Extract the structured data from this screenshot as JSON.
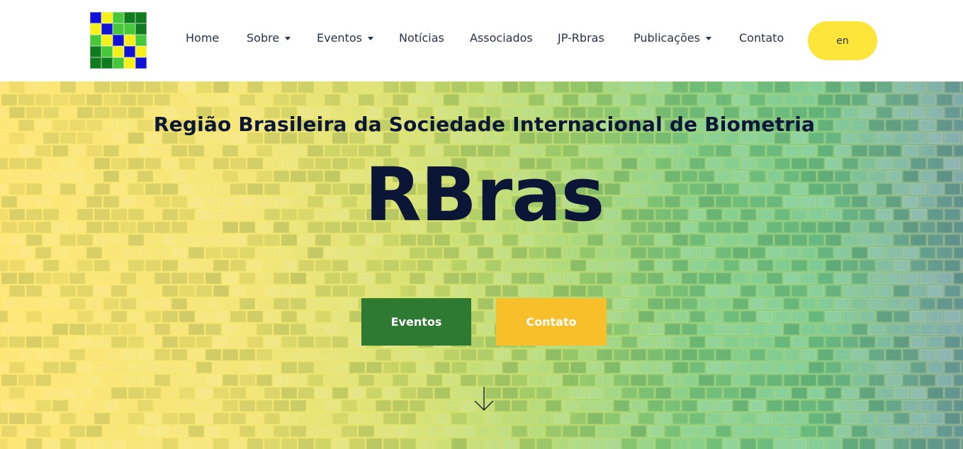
{
  "logo": {
    "cells": [
      "#1010d8",
      "#f5ef1a",
      "#46c83a",
      "#0f7a1e",
      "#0f7a1e",
      "#f5ef1a",
      "#1010d8",
      "#46c83a",
      "#46c83a",
      "#0f7a1e",
      "#46c83a",
      "#f5ef1a",
      "#1010d8",
      "#f5ef1a",
      "#46c83a",
      "#0f7a1e",
      "#46c83a",
      "#f5ef1a",
      "#1010d8",
      "#f5ef1a",
      "#0f7a1e",
      "#0f7a1e",
      "#46c83a",
      "#f5ef1a",
      "#1010d8"
    ]
  },
  "nav": {
    "items": [
      {
        "label": "Home",
        "dropdown": false
      },
      {
        "label": "Sobre",
        "dropdown": true
      },
      {
        "label": "Eventos",
        "dropdown": true
      },
      {
        "label": "Notícias",
        "dropdown": false
      },
      {
        "label": "Associados",
        "dropdown": false
      },
      {
        "label": "JP-Rbras",
        "dropdown": false
      },
      {
        "label": "Publicações",
        "dropdown": true
      },
      {
        "label": "Contato",
        "dropdown": false
      }
    ],
    "lang_label": "en"
  },
  "hero": {
    "subtitle": "Região Brasileira da Sociedade Internacional de Biometria",
    "title": "RBras",
    "primary_button": "Eventos",
    "secondary_button": "Contato"
  },
  "colors": {
    "accent_yellow": "#fde53a",
    "button_green": "#2e7a32",
    "button_yellow": "#f7bf2a",
    "heading_navy": "#0b1637"
  },
  "icons": {
    "caret": "chevron-down-icon",
    "scroll": "arrow-down-icon"
  }
}
